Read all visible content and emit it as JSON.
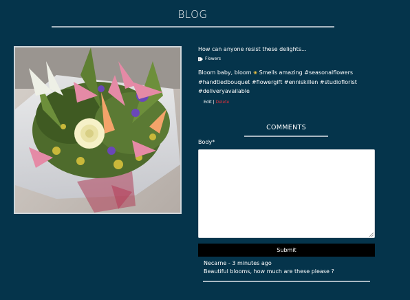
{
  "blog": {
    "title": "BLOG"
  },
  "post": {
    "title": "How can anyone resist these delights...",
    "category": "Flowers",
    "body_before_emoji": "Bloom baby, bloom",
    "body_after_emoji": " Smells amazing #seasonalflowers #handtiedbouquet #flowergift #enniskillen #studioflorist #deliveryavailable",
    "edit_label": "Edit",
    "separator": "|",
    "delete_label": "Delete",
    "image": {
      "subject": "bouquet of lilies, roses and mixed flowers wrapped in cellophane"
    }
  },
  "comments": {
    "title": "COMMENTS",
    "form": {
      "body_label": "Body*",
      "body_value": "",
      "submit_label": "Submit"
    },
    "items": [
      {
        "meta": "Necarne - 3 minutes ago",
        "text": "Beautiful blooms, how much are these please ?"
      }
    ]
  },
  "colors": {
    "background": "#05344b",
    "delete": "#e0323c",
    "submit_bg": "#000000"
  },
  "icons": {
    "tag": "tag-icon",
    "emoji": "flower-emoji"
  }
}
